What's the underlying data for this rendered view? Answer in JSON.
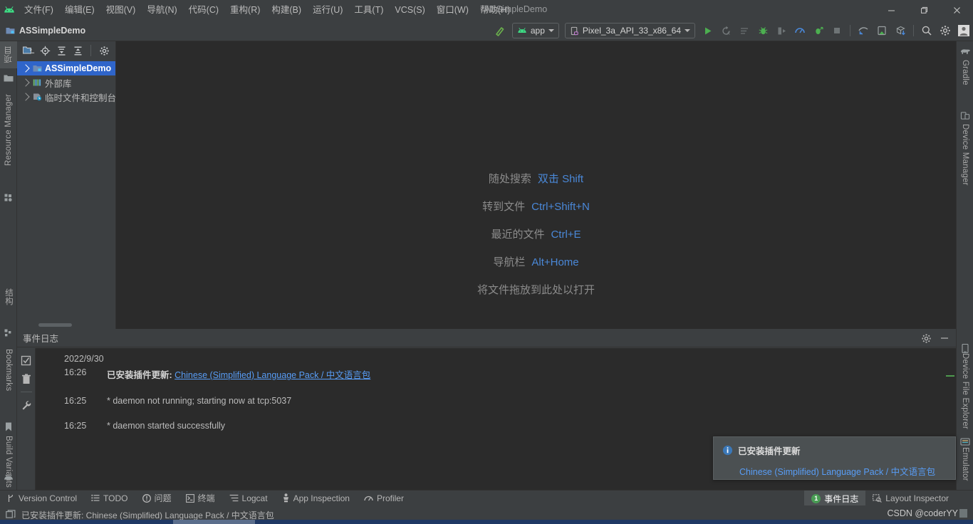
{
  "window": {
    "title": "ASSimpleDemo",
    "minimize_label": "–",
    "maximize_label": "❐",
    "close_label": "✕"
  },
  "menubar": {
    "logo": "android-logo-icon",
    "items": [
      {
        "label": "文件(F)",
        "name": "menu-file"
      },
      {
        "label": "编辑(E)",
        "name": "menu-edit"
      },
      {
        "label": "视图(V)",
        "name": "menu-view"
      },
      {
        "label": "导航(N)",
        "name": "menu-navigate"
      },
      {
        "label": "代码(C)",
        "name": "menu-code"
      },
      {
        "label": "重构(R)",
        "name": "menu-refactor"
      },
      {
        "label": "构建(B)",
        "name": "menu-build"
      },
      {
        "label": "运行(U)",
        "name": "menu-run"
      },
      {
        "label": "工具(T)",
        "name": "menu-tools"
      },
      {
        "label": "VCS(S)",
        "name": "menu-vcs"
      },
      {
        "label": "窗口(W)",
        "name": "menu-window"
      },
      {
        "label": "帮助(H)",
        "name": "menu-help"
      }
    ]
  },
  "toolbar": {
    "project_name": "ASSimpleDemo",
    "run_config": "app",
    "device": "Pixel_3a_API_33_x86_64",
    "icons": [
      "build-hammer-icon",
      "run-icon",
      "rerun-icon",
      "edit-configurations-icon",
      "debug-icon",
      "attach-debugger-icon",
      "profiler-icon",
      "apply-changes-icon",
      "stop-icon",
      "sync-gradle-icon",
      "avd-manager-icon",
      "sdk-manager-icon",
      "search-icon",
      "settings-gear-icon",
      "account-avatar-icon"
    ]
  },
  "left_tabs_top": [
    {
      "label": "项目",
      "name": "sidebar-tab-project",
      "icon": "project-icon",
      "active": true
    },
    {
      "label": "",
      "name": "sidebar-tab-folder",
      "icon": "folder-icon",
      "active": false
    },
    {
      "label": "Resource Manager",
      "name": "sidebar-tab-resource-manager",
      "icon": "resource-manager-icon",
      "active": false
    }
  ],
  "left_tabs_bottom": [
    {
      "label": "结构",
      "name": "sidebar-tab-structure",
      "icon": "structure-icon"
    },
    {
      "label": "Bookmarks",
      "name": "sidebar-tab-bookmarks",
      "icon": "bookmark-icon"
    },
    {
      "label": "Build Variants",
      "name": "sidebar-tab-build-variants",
      "icon": "build-variants-icon"
    }
  ],
  "right_tabs_top": [
    {
      "label": "Gradle",
      "name": "sidebar-tab-gradle",
      "icon": "gradle-elephant-icon"
    },
    {
      "label": "Device Manager",
      "name": "sidebar-tab-device-manager",
      "icon": "device-manager-icon"
    }
  ],
  "right_tabs_bottom": [
    {
      "label": "Device File Explorer",
      "name": "sidebar-tab-device-file-explorer",
      "icon": "device-file-explorer-icon"
    },
    {
      "label": "Emulator",
      "name": "sidebar-tab-emulator",
      "icon": "emulator-icon"
    }
  ],
  "project_panel": {
    "toolbar_icons": [
      "select-opened-file-icon",
      "scroll-from-source-icon",
      "expand-all-icon",
      "collapse-all-icon",
      "settings-gear-icon"
    ],
    "tree": [
      {
        "label": "ASSimpleDemo",
        "icon": "module-icon",
        "selected": true,
        "expandable": true
      },
      {
        "label": "外部库",
        "icon": "library-icon",
        "selected": false,
        "expandable": true
      },
      {
        "label": "临时文件和控制台",
        "icon": "scratches-icon",
        "selected": false,
        "expandable": true
      }
    ]
  },
  "editor": {
    "hints": [
      {
        "label": "随处搜索",
        "key": "双击 Shift"
      },
      {
        "label": "转到文件",
        "key": "Ctrl+Shift+N"
      },
      {
        "label": "最近的文件",
        "key": "Ctrl+E"
      },
      {
        "label": "导航栏",
        "key": "Alt+Home"
      },
      {
        "label": "将文件拖放到此处以打开",
        "key": ""
      }
    ]
  },
  "event_log": {
    "title": "事件日志",
    "side_icons": [
      "mark-all-read-icon",
      "delete-icon",
      "settings-wrench-icon"
    ],
    "header_icons": [
      "settings-gear-icon",
      "minimize-icon"
    ],
    "date": "2022/9/30",
    "entries": [
      {
        "time": "16:26",
        "bold": "已安装插件更新:",
        "link": "Chinese (Simplified) Language Pack / 中文语言包",
        "text": ""
      },
      {
        "time": "16:25",
        "bold": "",
        "link": "",
        "text": "* daemon not running; starting now at tcp:5037"
      },
      {
        "time": "16:25",
        "bold": "",
        "link": "",
        "text": "* daemon started successfully"
      }
    ]
  },
  "balloon": {
    "icon": "info-icon",
    "title": "已安装插件更新",
    "link": "Chinese (Simplified) Language Pack / 中文语言包"
  },
  "bottom_bar": {
    "left_items": [
      {
        "label": "Version Control",
        "icon": "branch-icon",
        "name": "tool-window-version-control"
      },
      {
        "label": "TODO",
        "icon": "todo-list-icon",
        "name": "tool-window-todo"
      },
      {
        "label": "问题",
        "icon": "problems-icon",
        "name": "tool-window-problems"
      },
      {
        "label": "终端",
        "icon": "terminal-icon",
        "name": "tool-window-terminal"
      },
      {
        "label": "Logcat",
        "icon": "logcat-icon",
        "name": "tool-window-logcat"
      },
      {
        "label": "App Inspection",
        "icon": "app-inspection-icon",
        "name": "tool-window-app-inspection"
      },
      {
        "label": "Profiler",
        "icon": "profiler-icon",
        "name": "tool-window-profiler"
      }
    ],
    "right_items": [
      {
        "label": "事件日志",
        "icon": "event-log-icon",
        "name": "tool-window-event-log",
        "badge": "1",
        "active": true
      },
      {
        "label": "Layout Inspector",
        "icon": "layout-inspector-icon",
        "name": "tool-window-layout-inspector",
        "badge": "",
        "active": false
      }
    ]
  },
  "status_bar": {
    "icon": "notification-icon",
    "text": "已安装插件更新: Chinese (Simplified) Language Pack / 中文语言包",
    "watermark": "CSDN @coderYY"
  },
  "colors": {
    "chrome": "#3c3f41",
    "editor_bg": "#2b2b2b",
    "selection": "#2f65ca",
    "link": "#589df6",
    "accent_green": "#499c54",
    "hint_key": "#4a88d8"
  }
}
